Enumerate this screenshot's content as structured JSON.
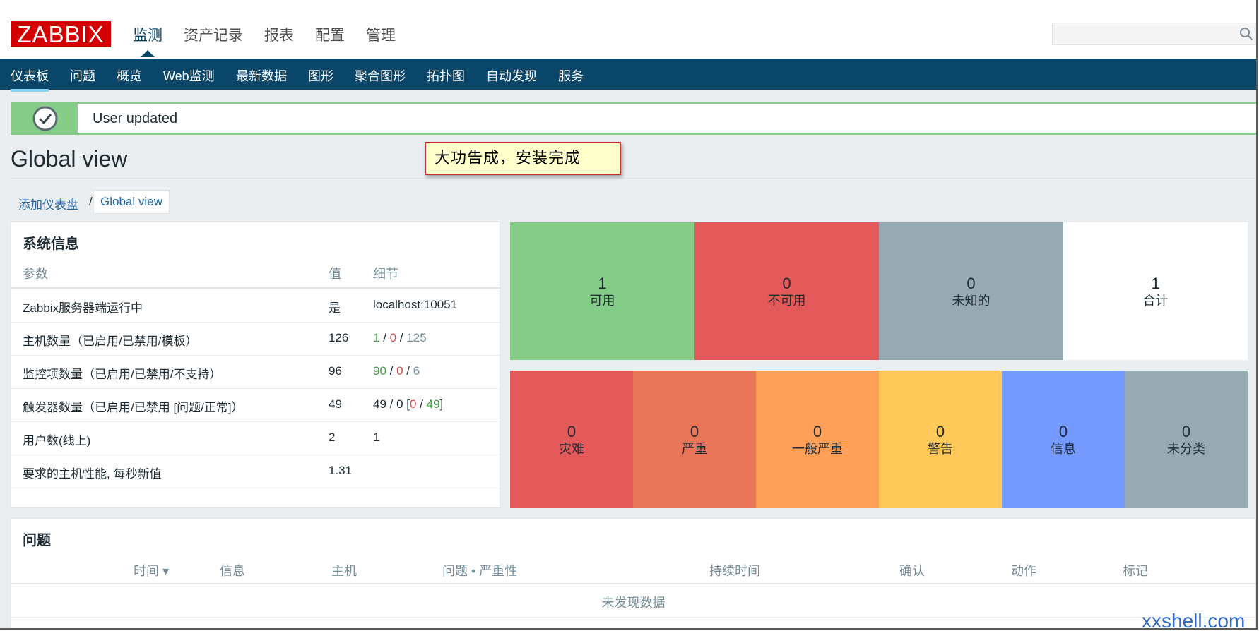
{
  "header": {
    "logo": "ZABBIX",
    "main_nav": [
      "监测",
      "资产记录",
      "报表",
      "配置",
      "管理"
    ],
    "search_placeholder": ""
  },
  "subnav": [
    "仪表板",
    "问题",
    "概览",
    "Web监测",
    "最新数据",
    "图形",
    "聚合图形",
    "拓扑图",
    "自动发现",
    "服务"
  ],
  "message": {
    "text": "User updated"
  },
  "page_title": "Global view",
  "callout": "大功告成，安装完成",
  "breadcrumb": {
    "link": "添加仪表盘",
    "sep": "/",
    "current": "Global view"
  },
  "system_info": {
    "title": "系统信息",
    "headers": [
      "参数",
      "值",
      "细节"
    ],
    "rows": [
      {
        "param": "Zabbix服务器端运行中",
        "value": "是",
        "detail": "localhost:10051"
      },
      {
        "param": "主机数量（已启用/已禁用/模板）",
        "value": "126",
        "d1": "1",
        "s1": " / ",
        "d2": "0",
        "s2": " / ",
        "d3": "125"
      },
      {
        "param": "监控项数量（已启用/已禁用/不支持）",
        "value": "96",
        "d1": "90",
        "s1": " / ",
        "d2": "0",
        "s2": " / ",
        "d3": "6"
      },
      {
        "param": "触发器数量（已启用/已禁用 [问题/正常]）",
        "value": "49",
        "d0": "49 / 0 [",
        "d1": "0",
        "s1": " / ",
        "d2": "49",
        "d3": "]"
      },
      {
        "param": "用户数(线上)",
        "value": "2",
        "detail": "1"
      },
      {
        "param": "要求的主机性能, 每秒新值",
        "value": "1.31",
        "detail": ""
      }
    ]
  },
  "host_status": [
    {
      "count": "1",
      "label": "可用",
      "color": "#86cc89"
    },
    {
      "count": "0",
      "label": "不可用",
      "color": "#e45959"
    },
    {
      "count": "0",
      "label": "未知的",
      "color": "#97aab3"
    },
    {
      "count": "1",
      "label": "合计",
      "color": "#ffffff"
    }
  ],
  "severity_status": [
    {
      "count": "0",
      "label": "灾难",
      "color": "#e45959"
    },
    {
      "count": "0",
      "label": "严重",
      "color": "#e97659"
    },
    {
      "count": "0",
      "label": "一般严重",
      "color": "#ffa059"
    },
    {
      "count": "0",
      "label": "警告",
      "color": "#ffc859"
    },
    {
      "count": "0",
      "label": "信息",
      "color": "#7499ff"
    },
    {
      "count": "0",
      "label": "未分类",
      "color": "#97aab3"
    }
  ],
  "problems": {
    "title": "问题",
    "headers": [
      "时间 ▾",
      "信息",
      "主机",
      "问题 • 严重性",
      "持续时间",
      "确认",
      "动作",
      "标记"
    ],
    "empty": "未发现数据"
  },
  "watermark": "xxshell.com"
}
